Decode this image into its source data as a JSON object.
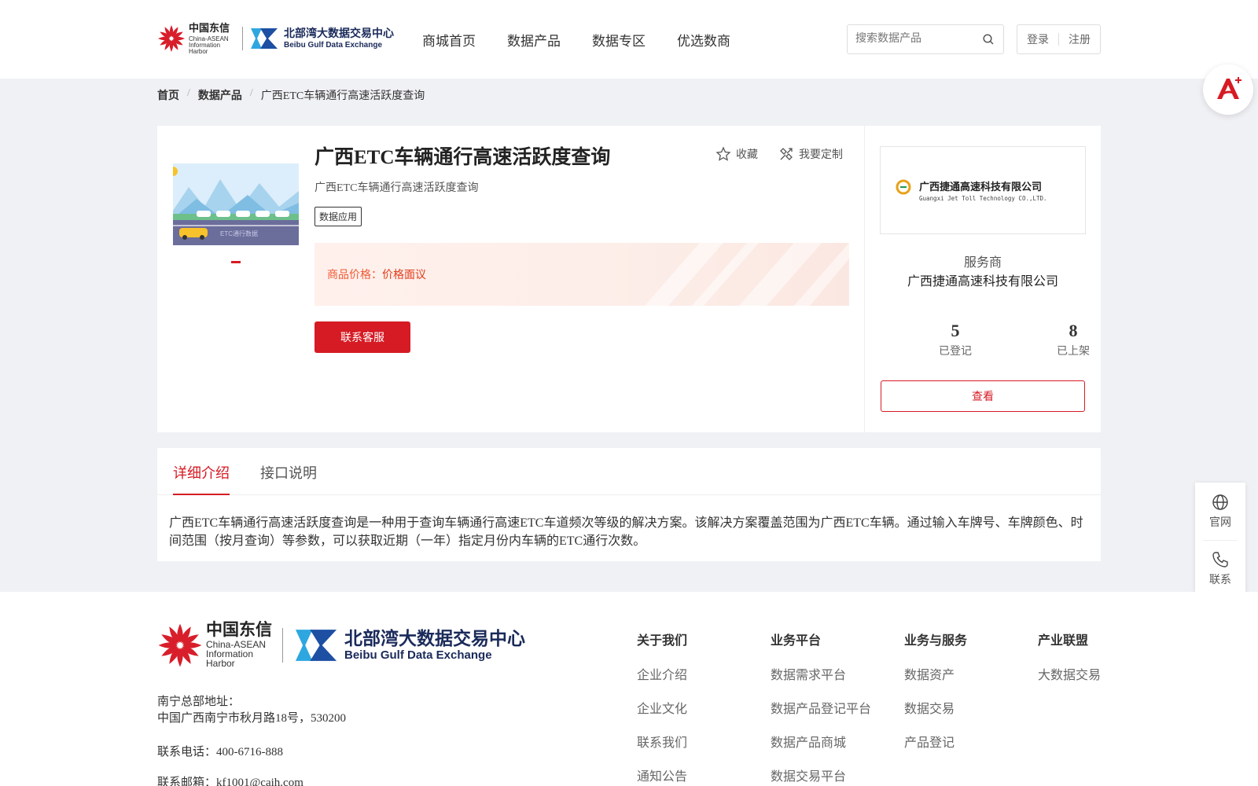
{
  "header": {
    "logo_primary_cn": "中国东信",
    "logo_primary_en": "China-ASEAN Information Harbor",
    "logo_secondary_cn": "北部湾大数据交易中心",
    "logo_secondary_en": "Beibu Gulf Data Exchange",
    "nav": [
      "商城首页",
      "数据产品",
      "数据专区",
      "优选数商"
    ],
    "search_placeholder": "搜索数据产品",
    "login": "登录",
    "register": "注册"
  },
  "breadcrumb": [
    "首页",
    "数据产品",
    "广西ETC车辆通行高速活跃度查询"
  ],
  "product": {
    "title": "广西ETC车辆通行高速活跃度查询",
    "subtitle": "广西ETC车辆通行高速活跃度查询",
    "tag": "数据应用",
    "favorite_label": "收藏",
    "customize_label": "我要定制",
    "price_label": "商品价格：",
    "price_value": "价格面议",
    "contact_button": "联系客服",
    "thumb_text": "ETC通行数据"
  },
  "vendor": {
    "logo_cn": "广西捷通高速科技有限公司",
    "logo_en": "Guangxi Jet Toll Technology CO.,LTD.",
    "role": "服务商",
    "name": "广西捷通高速科技有限公司",
    "stats": [
      {
        "value": "5",
        "label": "已登记"
      },
      {
        "value": "8",
        "label": "已上架"
      }
    ],
    "view_button": "查看"
  },
  "tabs": [
    "详细介绍",
    "接口说明"
  ],
  "description": "广西ETC车辆通行高速活跃度查询是一种用于查询车辆通行高速ETC车道频次等级的解决方案。该解决方案覆盖范围为广西ETC车辆。通过输入车牌号、车牌颜色、时间范围（按月查询）等参数，可以获取近期（一年）指定月份内车辆的ETC通行次数。",
  "side_float": [
    "官网",
    "联系"
  ],
  "footer": {
    "address_label": "南宁总部地址：",
    "address": "中国广西南宁市秋月路18号，530200",
    "phone": "联系电话：400-6716-888",
    "email": "联系邮箱：kf1001@caih.com",
    "columns": [
      {
        "title": "关于我们",
        "links": [
          "企业介绍",
          "企业文化",
          "联系我们",
          "通知公告"
        ]
      },
      {
        "title": "业务平台",
        "links": [
          "数据需求平台",
          "数据产品登记平台",
          "数据产品商城",
          "数据交易平台"
        ]
      },
      {
        "title": "业务与服务",
        "links": [
          "数据资产",
          "数据交易",
          "产品登记"
        ]
      },
      {
        "title": "产业联盟",
        "links": [
          "大数据交易"
        ]
      }
    ]
  },
  "colors": {
    "brand_red": "#d61b24",
    "price_orange": "#f05a33",
    "navy": "#1a2a5a"
  }
}
